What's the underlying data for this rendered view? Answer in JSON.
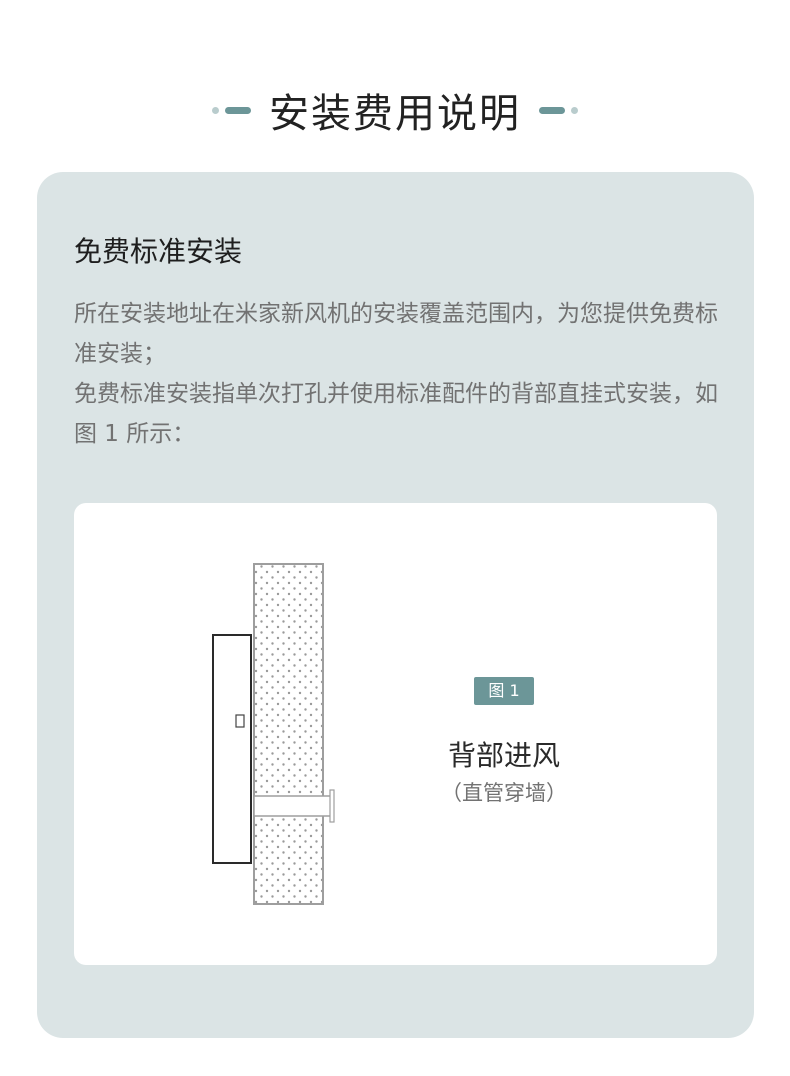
{
  "header": {
    "title": "安装费用说明"
  },
  "section": {
    "heading": "免费标准安装",
    "paragraphs": [
      "所在安装地址在米家新风机的安装覆盖范围内，为您提供免费标准安装；",
      "免费标准安装指单次打孔并使用标准配件的背部直挂式安装，如图 1 所示："
    ]
  },
  "figure": {
    "badge": "图 1",
    "label": "背部进风",
    "sublabel": "（直管穿墙）"
  },
  "colors": {
    "accent": "#6c9698",
    "card_bg": "#dbe4e5",
    "body_text": "#727272",
    "heading_text": "#1e1e1e"
  }
}
